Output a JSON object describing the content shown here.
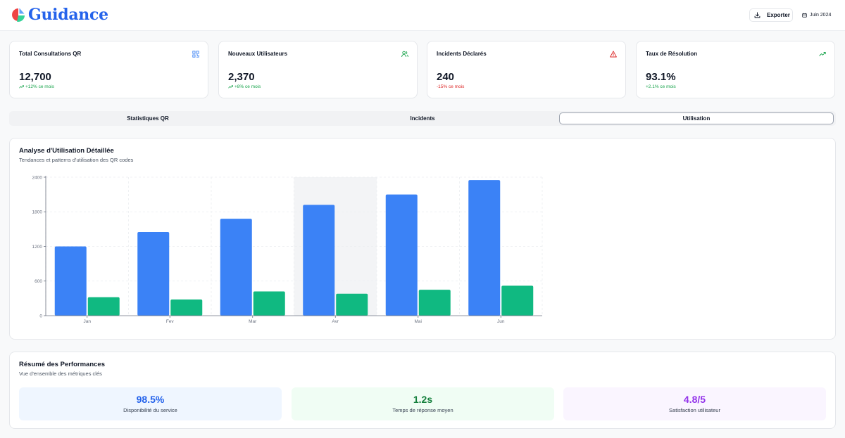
{
  "header": {
    "brand": "Guidance",
    "export_label": "Exporter",
    "date_label": "Juin 2024"
  },
  "kpis": [
    {
      "title": "Total Consultations QR",
      "value": "12,700",
      "change": "+12% ce mois",
      "trend": "up",
      "icon": "qr-code-icon",
      "icon_color": "#3b82f6"
    },
    {
      "title": "Nouveaux Utilisateurs",
      "value": "2,370",
      "change": "+8% ce mois",
      "trend": "up",
      "icon": "users-icon",
      "icon_color": "#16a34a"
    },
    {
      "title": "Incidents Déclarés",
      "value": "240",
      "change": "-15% ce mois",
      "trend": "down",
      "icon": "alert-triangle-icon",
      "icon_color": "#dc2626"
    },
    {
      "title": "Taux de Résolution",
      "value": "93.1%",
      "change": "+2.1% ce mois",
      "trend": "up",
      "icon": "trending-up-icon",
      "icon_color": "#16a34a"
    }
  ],
  "tabs": [
    {
      "label": "Statistiques QR",
      "active": false
    },
    {
      "label": "Incidents",
      "active": false
    },
    {
      "label": "Utilisation",
      "active": true
    }
  ],
  "usage": {
    "title": "Analyse d'Utilisation Détaillée",
    "subtitle": "Tendances et patterns d'utilisation des QR codes"
  },
  "chart_data": {
    "type": "bar",
    "categories": [
      "Jan",
      "Fev",
      "Mar",
      "Avr",
      "Mai",
      "Jun"
    ],
    "series": [
      {
        "values": [
          1200,
          1450,
          1680,
          1920,
          2100,
          2350
        ],
        "color": "#3b82f6"
      },
      {
        "values": [
          320,
          280,
          420,
          380,
          450,
          520
        ],
        "color": "#10b981"
      }
    ],
    "ylim": [
      0,
      2400
    ],
    "yticks": [
      0,
      600,
      1200,
      1800,
      2400
    ],
    "grid": true,
    "highlighted_category": "Avr"
  },
  "performance": {
    "title": "Résumé des Performances",
    "subtitle": "Vue d'ensemble des métriques clés",
    "items": [
      {
        "value": "98.5%",
        "label": "Disponibilité du service",
        "color": "#2563eb",
        "bg": "#eff6ff"
      },
      {
        "value": "1.2s",
        "label": "Temps de réponse moyen",
        "color": "#15803d",
        "bg": "#f0fdf4"
      },
      {
        "value": "4.8/5",
        "label": "Satisfaction utilisateur",
        "color": "#9333ea",
        "bg": "#faf5ff"
      }
    ]
  }
}
